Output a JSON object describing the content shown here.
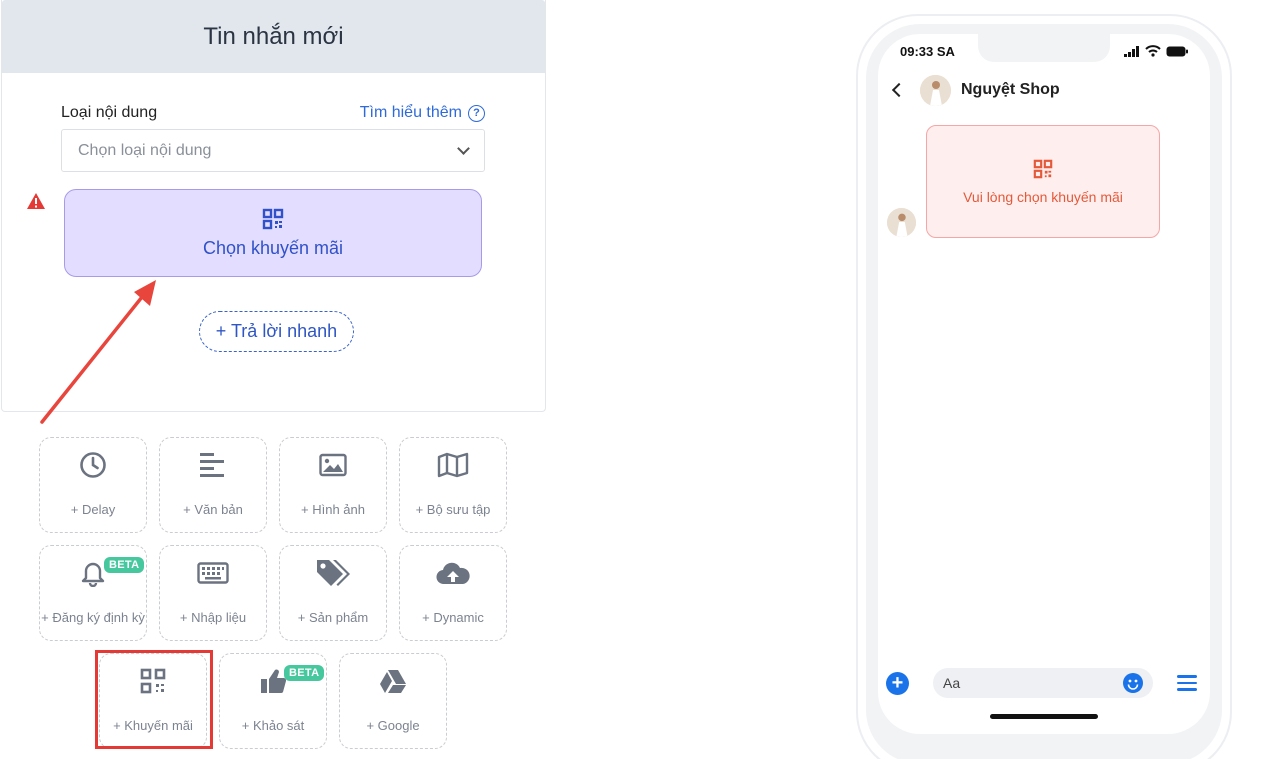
{
  "editor": {
    "title": "Tin nhắn mới",
    "content_type_label": "Loại nội dung",
    "learn_more": "Tìm hiểu thêm",
    "select_placeholder": "Chọn loại nội dung",
    "promo_button_label": "Chọn khuyến mãi",
    "quick_reply_label": "+ Trả lời nhanh"
  },
  "tiles": {
    "delay": "+ Delay",
    "text": "+ Văn bản",
    "image": "+ Hình ảnh",
    "gallery": "+ Bộ sưu tập",
    "subscribe": "+ Đăng ký định kỳ",
    "input": "+ Nhập liệu",
    "product": "+ Sản phẩm",
    "dynamic": "+ Dynamic",
    "promo": "+ Khuyến mãi",
    "survey": "+ Khảo sát",
    "google": "+ Google",
    "beta_badge": "BETA"
  },
  "phone": {
    "time": "09:33 SA",
    "shop_name": "Nguyệt Shop",
    "bubble_text": "Vui lòng chọn khuyến mãi",
    "input_placeholder": "Aa"
  },
  "colors": {
    "accent_blue": "#2f6bd8",
    "promo_bg": "#e3deff",
    "warning_red": "#e53935",
    "beta_green": "#47c79e",
    "messenger_blue": "#1a73e8"
  }
}
